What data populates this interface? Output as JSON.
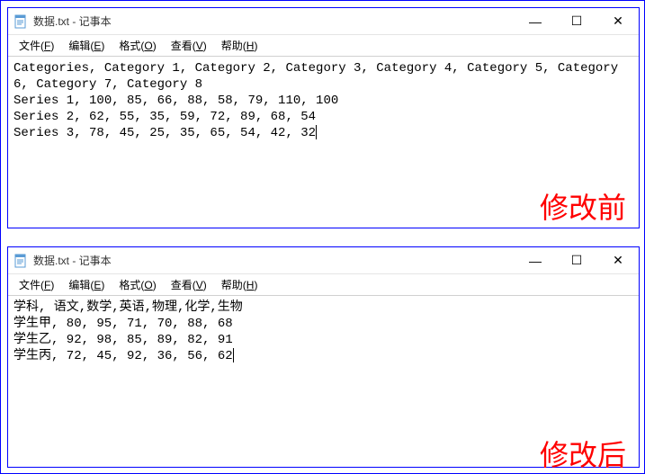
{
  "window1": {
    "title": "数据.txt - 记事本",
    "menu": {
      "file": {
        "label": "文件",
        "accel": "F"
      },
      "edit": {
        "label": "编辑",
        "accel": "E"
      },
      "format": {
        "label": "格式",
        "accel": "O"
      },
      "view": {
        "label": "查看",
        "accel": "V"
      },
      "help": {
        "label": "帮助",
        "accel": "H"
      }
    },
    "content": "Categories, Category 1, Category 2, Category 3, Category 4, Category 5, Category 6, Category 7, Category 8\nSeries 1, 100, 85, 66, 88, 58, 79, 110, 100\nSeries 2, 62, 55, 35, 59, 72, 89, 68, 54\nSeries 3, 78, 45, 25, 35, 65, 54, 42, 32"
  },
  "window2": {
    "title": "数据.txt - 记事本",
    "menu": {
      "file": {
        "label": "文件",
        "accel": "F"
      },
      "edit": {
        "label": "编辑",
        "accel": "E"
      },
      "format": {
        "label": "格式",
        "accel": "O"
      },
      "view": {
        "label": "查看",
        "accel": "V"
      },
      "help": {
        "label": "帮助",
        "accel": "H"
      }
    },
    "content": "学科, 语文,数学,英语,物理,化学,生物\n学生甲, 80, 95, 71, 70, 88, 68\n学生乙, 92, 98, 85, 89, 82, 91\n学生丙, 72, 45, 92, 36, 56, 62"
  },
  "annotations": {
    "before": "修改前",
    "after": "修改后"
  },
  "winbuttons": {
    "minimize": "—",
    "maximize": "☐",
    "close": "✕"
  }
}
